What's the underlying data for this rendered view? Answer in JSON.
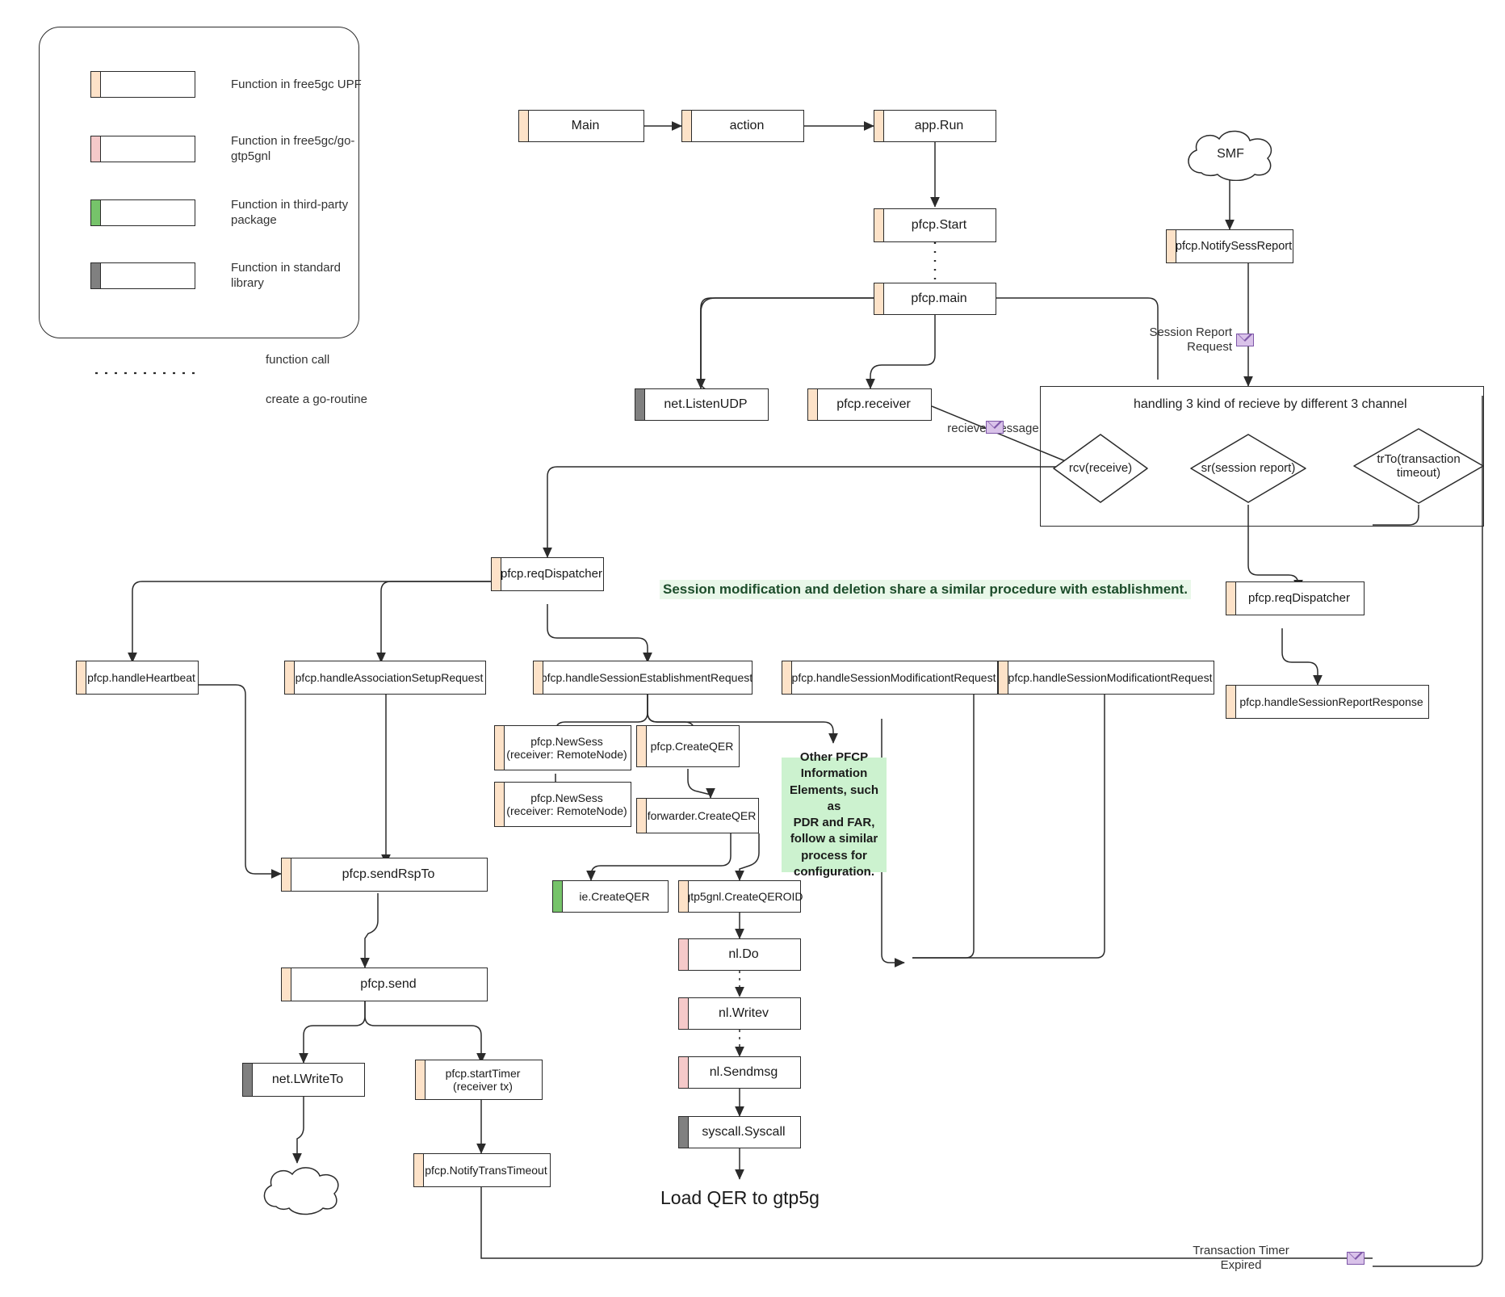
{
  "legend": {
    "items": [
      {
        "kind": "upf",
        "label": "Function in free5gc\nUPF"
      },
      {
        "kind": "gtp",
        "label": "Function in free5gc/go-\ngtp5gnl"
      },
      {
        "kind": "third",
        "label": "Function in third-party\npackage"
      },
      {
        "kind": "std",
        "label": "Function in standard\nlibrary"
      }
    ],
    "arrow_label": "function call",
    "dotted_label": "create a go-routine"
  },
  "nodes": {
    "main": "Main",
    "action": "action",
    "app_run": "app.Run",
    "pfcp_start": "pfcp.Start",
    "pfcp_main": "pfcp.main",
    "net_listen_udp": "net.ListenUDP",
    "pfcp_receiver": "pfcp.receiver",
    "pfcp_notify_sess_report": "pfcp.NotifySessReport",
    "req_dispatcher_left": "pfcp.reqDispatcher",
    "req_dispatcher_right": "pfcp.reqDispatcher",
    "handle_heartbeat": "pfcp.handleHeartbeat",
    "handle_assoc_setup": "pfcp.handleAssociationSetupRequest",
    "handle_sess_establish": "pfcp.handleSessionEstablishmentRequest",
    "handle_sess_modify_1": "pfcp.handleSessionModificationtRequest",
    "handle_sess_modify_2": "pfcp.handleSessionModificationtRequest",
    "handle_sess_report_response": "pfcp.handleSessionReportResponse",
    "new_sess_1": "pfcp.NewSess\n(receiver: RemoteNode)",
    "new_sess_2": "pfcp.NewSess\n(receiver: RemoteNode)",
    "pfcp_create_qer": "pfcp.CreateQER",
    "forwarder_create_qer": "forwarder.CreateQER",
    "ie_create_qer": "ie.CreateQER",
    "gtp5gnl_create_qeroid": "gtp5gnl.CreateQEROID",
    "nl_do": "nl.Do",
    "nl_writev": "nl.Writev",
    "nl_sendmsg": "nl.Sendmsg",
    "syscall_syscall": "syscall.Syscall",
    "send_rsp_to": "pfcp.sendRspTo",
    "pfcp_send": "pfcp.send",
    "net_lwriteto": "net.LWriteTo",
    "start_timer": "pfcp.startTimer\n(receiver tx)",
    "notify_trans_timeout": "pfcp.NotifyTransTimeout"
  },
  "clouds": {
    "smf": "SMF",
    "network": ""
  },
  "group": {
    "title": "handling 3 kind of recieve by different 3 channel",
    "diamonds": [
      {
        "id": "rcv",
        "label": "rcv(receive)"
      },
      {
        "id": "sr",
        "label": "sr(session report)"
      },
      {
        "id": "trto",
        "label": "trTo(transaction\ntimeout)"
      }
    ]
  },
  "labels": {
    "session_report_request": "Session Report\nRequest",
    "recieve_message": "recieve message",
    "transaction_timer_expired": "Transaction Timer\nExpired",
    "load_qer": "Load QER to gtp5g",
    "share_banner": "Session modification and deletion share a similar procedure with establishment.",
    "other_pfcp_note": "Other PFCP\nInformation\nElements, such as\nPDR and FAR,\nfollow a similar\nprocess for\nconfiguration."
  },
  "colors": {
    "upf": "#fde2c8",
    "gtp": "#f5c9c9",
    "third": "#76c36a",
    "std": "#808080",
    "note_green": "#ccf2cf",
    "banner_green": "#e9f7e9",
    "envelope": "#d9c2e9",
    "stroke": "#2b2b2b"
  }
}
